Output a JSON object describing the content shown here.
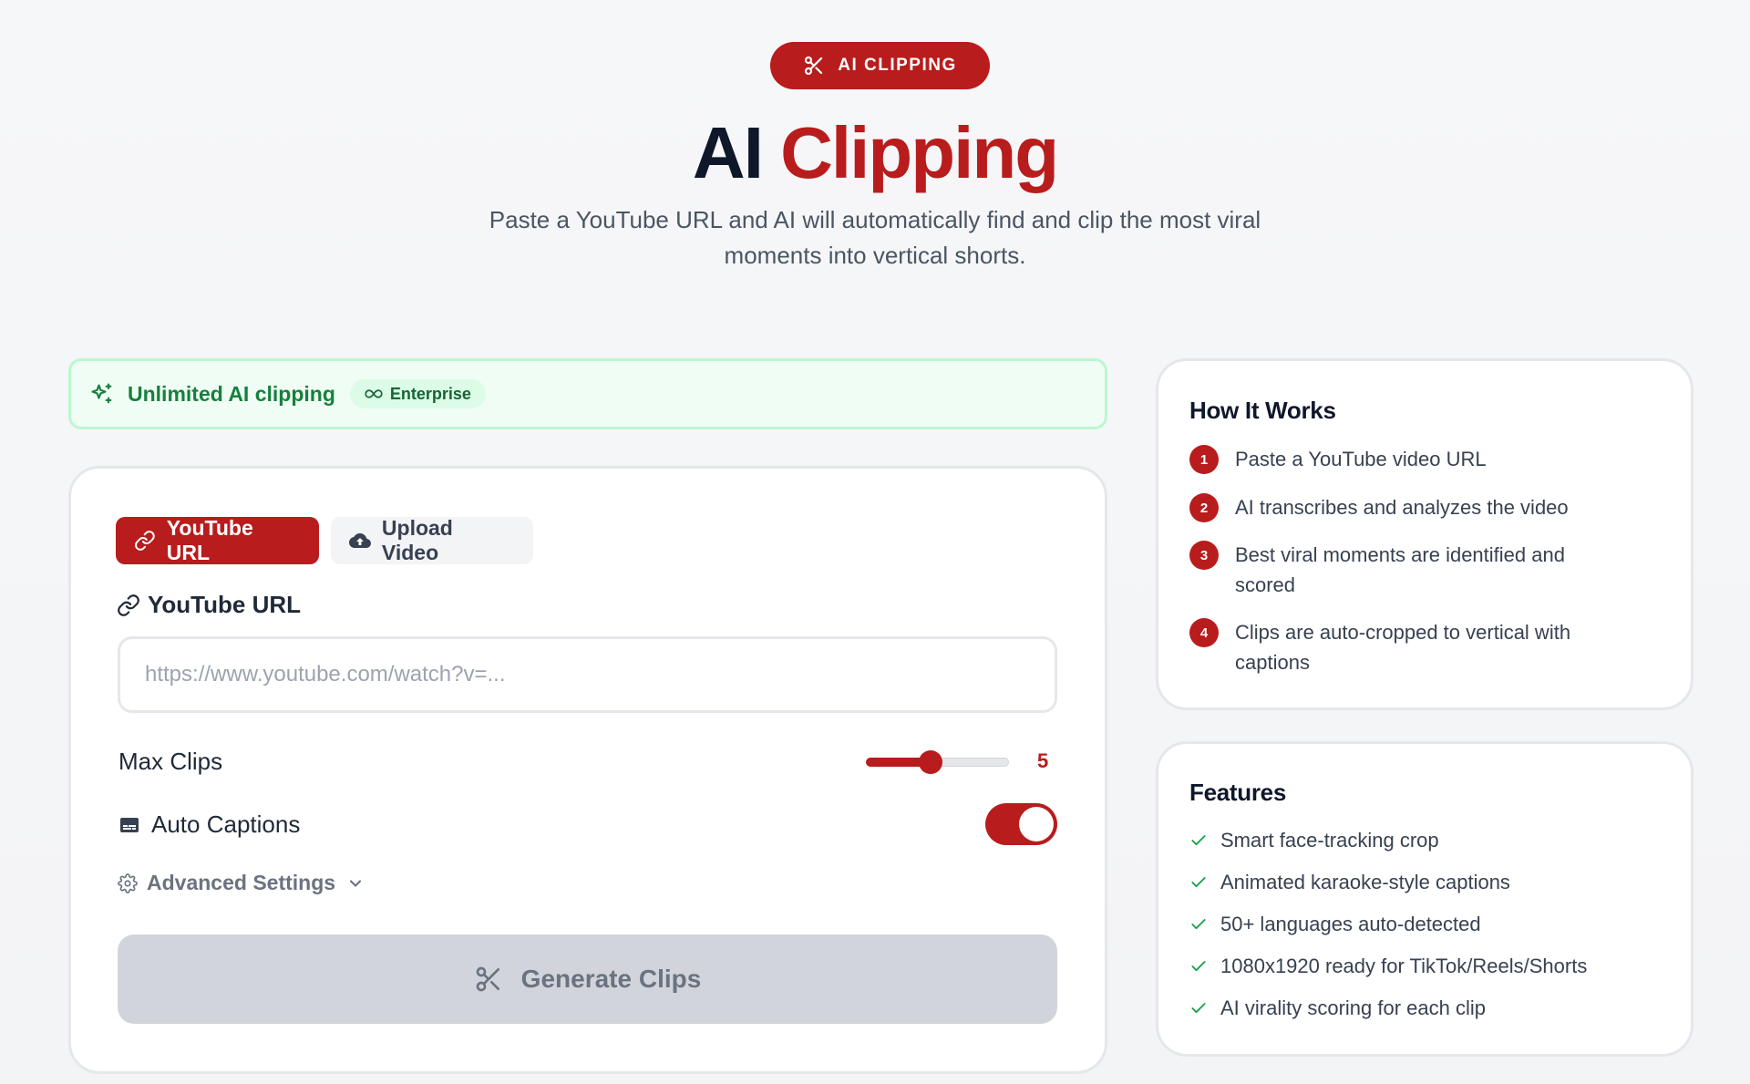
{
  "hero": {
    "badge_label": "AI CLIPPING",
    "title_part1": "AI",
    "title_part2": "Clipping",
    "subtitle": "Paste a YouTube URL and AI will automatically find and clip the most viral moments into vertical shorts."
  },
  "banner": {
    "label": "Unlimited AI clipping",
    "plan_badge": "Enterprise"
  },
  "form": {
    "tabs": [
      {
        "label": "YouTube URL",
        "icon": "link-icon",
        "active": true
      },
      {
        "label": "Upload Video",
        "icon": "cloud-upload-icon",
        "active": false
      }
    ],
    "url_label": "YouTube URL",
    "url_value": "",
    "url_placeholder": "https://www.youtube.com/watch?v=...",
    "max_clips_label": "Max Clips",
    "max_clips_value": "5",
    "max_clips_fraction": 0.45,
    "auto_captions_label": "Auto Captions",
    "auto_captions_on": true,
    "advanced_label": "Advanced Settings",
    "generate_label": "Generate Clips"
  },
  "how_it_works": {
    "title": "How It Works",
    "steps": [
      {
        "num": "1",
        "text": "Paste a YouTube video URL"
      },
      {
        "num": "2",
        "text": "AI transcribes and analyzes the video"
      },
      {
        "num": "3",
        "text": "Best viral moments are identified and scored"
      },
      {
        "num": "4",
        "text": "Clips are auto-cropped to vertical with captions"
      }
    ]
  },
  "features": {
    "title": "Features",
    "items": [
      "Smart face-tracking crop",
      "Animated karaoke-style captions",
      "50+ languages auto-detected",
      "1080x1920 ready for TikTok/Reels/Shorts",
      "AI virality scoring for each clip"
    ]
  },
  "colors": {
    "accent": "#b91c1c",
    "success": "#15803d",
    "muted": "#6b7280"
  }
}
